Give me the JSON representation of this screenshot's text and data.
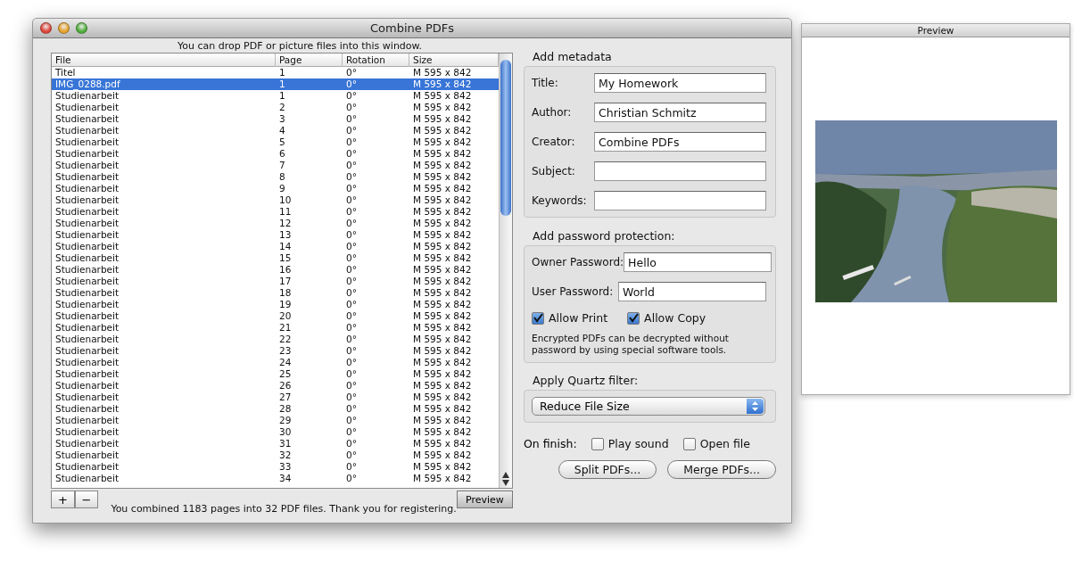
{
  "window": {
    "title": "Combine PDFs"
  },
  "drop_hint": "You can drop PDF or picture files into this window.",
  "table": {
    "columns": [
      "File",
      "Page",
      "Rotation",
      "Size"
    ],
    "rows": [
      {
        "file": "Titel",
        "page": "1",
        "rotation": "0°",
        "size": "M 595 x 842",
        "selected": false
      },
      {
        "file": "IMG_0288.pdf",
        "page": "1",
        "rotation": "0°",
        "size": "M 595 x 842",
        "selected": true
      },
      {
        "file": "Studienarbeit",
        "page": "1",
        "rotation": "0°",
        "size": "M 595 x 842",
        "selected": false
      },
      {
        "file": "Studienarbeit",
        "page": "2",
        "rotation": "0°",
        "size": "M 595 x 842",
        "selected": false
      },
      {
        "file": "Studienarbeit",
        "page": "3",
        "rotation": "0°",
        "size": "M 595 x 842",
        "selected": false
      },
      {
        "file": "Studienarbeit",
        "page": "4",
        "rotation": "0°",
        "size": "M 595 x 842",
        "selected": false
      },
      {
        "file": "Studienarbeit",
        "page": "5",
        "rotation": "0°",
        "size": "M 595 x 842",
        "selected": false
      },
      {
        "file": "Studienarbeit",
        "page": "6",
        "rotation": "0°",
        "size": "M 595 x 842",
        "selected": false
      },
      {
        "file": "Studienarbeit",
        "page": "7",
        "rotation": "0°",
        "size": "M 595 x 842",
        "selected": false
      },
      {
        "file": "Studienarbeit",
        "page": "8",
        "rotation": "0°",
        "size": "M 595 x 842",
        "selected": false
      },
      {
        "file": "Studienarbeit",
        "page": "9",
        "rotation": "0°",
        "size": "M 595 x 842",
        "selected": false
      },
      {
        "file": "Studienarbeit",
        "page": "10",
        "rotation": "0°",
        "size": "M 595 x 842",
        "selected": false
      },
      {
        "file": "Studienarbeit",
        "page": "11",
        "rotation": "0°",
        "size": "M 595 x 842",
        "selected": false
      },
      {
        "file": "Studienarbeit",
        "page": "12",
        "rotation": "0°",
        "size": "M 595 x 842",
        "selected": false
      },
      {
        "file": "Studienarbeit",
        "page": "13",
        "rotation": "0°",
        "size": "M 595 x 842",
        "selected": false
      },
      {
        "file": "Studienarbeit",
        "page": "14",
        "rotation": "0°",
        "size": "M 595 x 842",
        "selected": false
      },
      {
        "file": "Studienarbeit",
        "page": "15",
        "rotation": "0°",
        "size": "M 595 x 842",
        "selected": false
      },
      {
        "file": "Studienarbeit",
        "page": "16",
        "rotation": "0°",
        "size": "M 595 x 842",
        "selected": false
      },
      {
        "file": "Studienarbeit",
        "page": "17",
        "rotation": "0°",
        "size": "M 595 x 842",
        "selected": false
      },
      {
        "file": "Studienarbeit",
        "page": "18",
        "rotation": "0°",
        "size": "M 595 x 842",
        "selected": false
      },
      {
        "file": "Studienarbeit",
        "page": "19",
        "rotation": "0°",
        "size": "M 595 x 842",
        "selected": false
      },
      {
        "file": "Studienarbeit",
        "page": "20",
        "rotation": "0°",
        "size": "M 595 x 842",
        "selected": false
      },
      {
        "file": "Studienarbeit",
        "page": "21",
        "rotation": "0°",
        "size": "M 595 x 842",
        "selected": false
      },
      {
        "file": "Studienarbeit",
        "page": "22",
        "rotation": "0°",
        "size": "M 595 x 842",
        "selected": false
      },
      {
        "file": "Studienarbeit",
        "page": "23",
        "rotation": "0°",
        "size": "M 595 x 842",
        "selected": false
      },
      {
        "file": "Studienarbeit",
        "page": "24",
        "rotation": "0°",
        "size": "M 595 x 842",
        "selected": false
      },
      {
        "file": "Studienarbeit",
        "page": "25",
        "rotation": "0°",
        "size": "M 595 x 842",
        "selected": false
      },
      {
        "file": "Studienarbeit",
        "page": "26",
        "rotation": "0°",
        "size": "M 595 x 842",
        "selected": false
      },
      {
        "file": "Studienarbeit",
        "page": "27",
        "rotation": "0°",
        "size": "M 595 x 842",
        "selected": false
      },
      {
        "file": "Studienarbeit",
        "page": "28",
        "rotation": "0°",
        "size": "M 595 x 842",
        "selected": false
      },
      {
        "file": "Studienarbeit",
        "page": "29",
        "rotation": "0°",
        "size": "M 595 x 842",
        "selected": false
      },
      {
        "file": "Studienarbeit",
        "page": "30",
        "rotation": "0°",
        "size": "M 595 x 842",
        "selected": false
      },
      {
        "file": "Studienarbeit",
        "page": "31",
        "rotation": "0°",
        "size": "M 595 x 842",
        "selected": false
      },
      {
        "file": "Studienarbeit",
        "page": "32",
        "rotation": "0°",
        "size": "M 595 x 842",
        "selected": false
      },
      {
        "file": "Studienarbeit",
        "page": "33",
        "rotation": "0°",
        "size": "M 595 x 842",
        "selected": false
      },
      {
        "file": "Studienarbeit",
        "page": "34",
        "rotation": "0°",
        "size": "M 595 x 842",
        "selected": false
      }
    ]
  },
  "list_buttons": [
    "+",
    "−"
  ],
  "status": "You combined 1183 pages into 32 PDF files. Thank you for registering.",
  "preview_button": "Preview",
  "metadata": {
    "title": "Add metadata",
    "fields": [
      {
        "label": "Title:",
        "value": "My Homework"
      },
      {
        "label": "Author:",
        "value": "Christian Schmitz"
      },
      {
        "label": "Creator:",
        "value": "Combine PDFs"
      },
      {
        "label": "Subject:"
      },
      {
        "label": "Keywords:"
      }
    ]
  },
  "password": {
    "title": "Add password protection:",
    "fields": [
      {
        "label": "Owner Password:",
        "value": "Hello"
      },
      {
        "label": "User Password:",
        "value": "World"
      }
    ],
    "checkboxes": [
      {
        "label": "Allow Print",
        "checked": true
      },
      {
        "label": "Allow Copy",
        "checked": true
      }
    ],
    "note": "Encrypted PDFs can be decrypted without password by using special software tools."
  },
  "quartz_filter": {
    "title": "Apply Quartz filter:",
    "value": "Reduce File Size"
  },
  "on_finish": {
    "label": "On finish:",
    "checkboxes": [
      {
        "label": "Play sound",
        "checked": false
      },
      {
        "label": "Open file",
        "checked": false
      }
    ]
  },
  "buttons": [
    "Split PDFs...",
    "Merge PDFs..."
  ],
  "preview_window": {
    "title": "Preview"
  }
}
